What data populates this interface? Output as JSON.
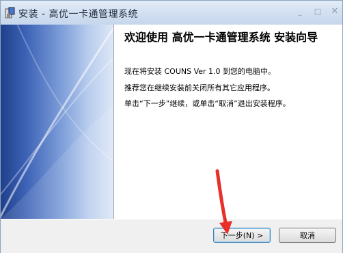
{
  "window": {
    "title": "安装 - 高优一卡通管理系统"
  },
  "controls": {
    "minimize": "_",
    "maximize": "□",
    "close": "✕"
  },
  "wizard": {
    "heading": "欢迎使用 高优一卡通管理系统 安装向导",
    "lines": [
      "现在将安装 COUNS Ver 1.0 到您的电脑中。",
      "推荐您在继续安装前关闭所有其它应用程序。",
      "单击“下一步”继续，或单击“取消”退出安装程序。"
    ]
  },
  "buttons": {
    "next": "下一步(N) >",
    "cancel": "取消"
  },
  "colors": {
    "arrow": "#e8302a",
    "sidebar_dark": "#1f3f8a",
    "sidebar_light": "#dde7f7"
  }
}
